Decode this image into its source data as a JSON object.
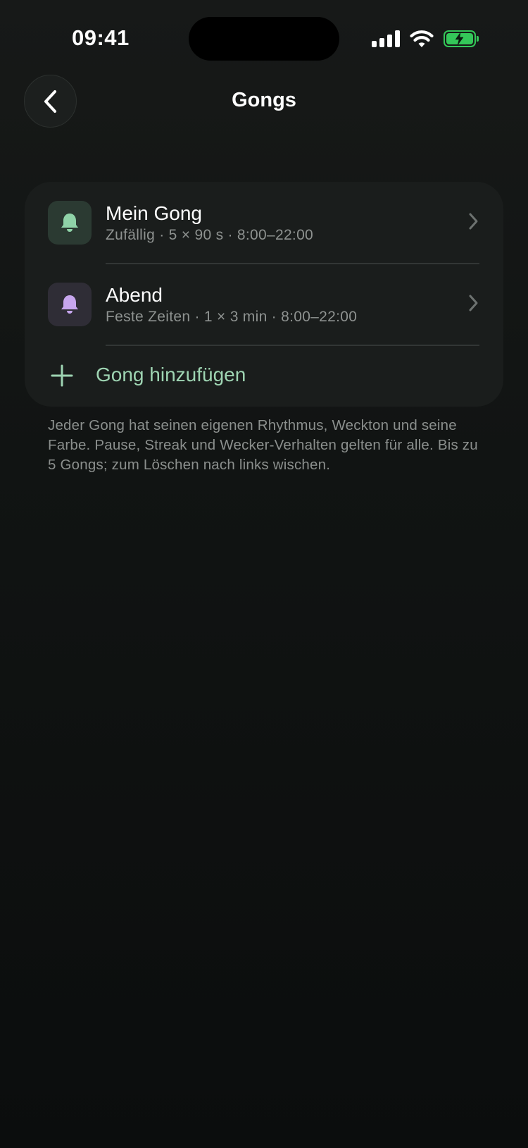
{
  "status": {
    "time": "09:41"
  },
  "nav": {
    "title": "Gongs"
  },
  "gongs": [
    {
      "title": "Mein Gong",
      "subtitle": "Zufällig · 5 × 90 s · 8:00–22:00",
      "color": "#8fd3a8",
      "icon_bg": "#2b3a32",
      "icon": "bell-icon"
    },
    {
      "title": "Abend",
      "subtitle": "Feste Zeiten · 1 × 3 min · 8:00–22:00",
      "color": "#c7a6ee",
      "icon_bg": "#2f2d36",
      "icon": "bell-icon"
    }
  ],
  "add": {
    "label": "Gong hinzufügen",
    "color": "#9ed4b2"
  },
  "footnote": "Jeder Gong hat seinen eigenen Rhythmus, Weckton und seine Farbe. Pause, Streak und Wecker-Verhalten gelten für alle. Bis zu 5 Gongs; zum Löschen nach links wischen."
}
